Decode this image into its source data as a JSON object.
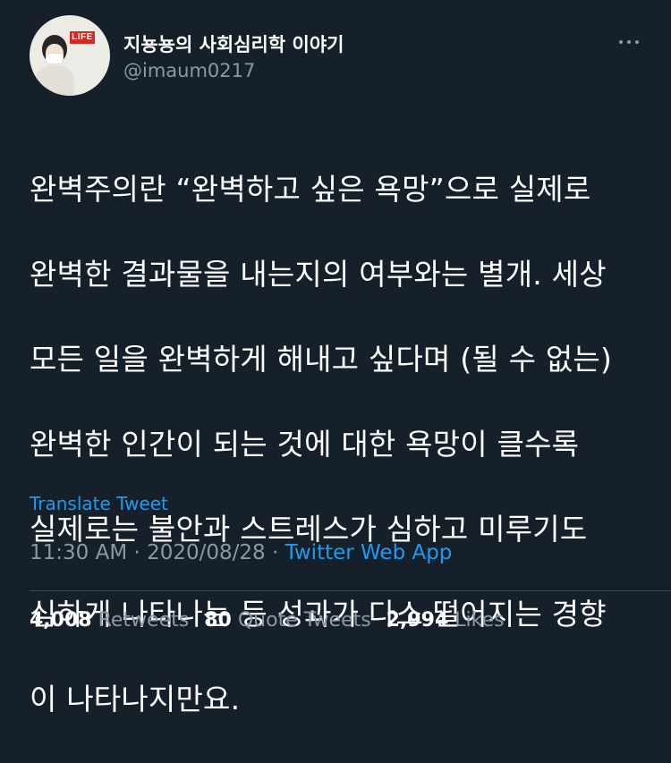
{
  "author": {
    "display_name": "지뇽뇽의 사회심리학 이야기",
    "handle": "@imaum0217",
    "avatar_sign_text": "LIFE"
  },
  "tweet": {
    "text_lines": [
      "완벽주의란 “완벽하고 싶은 욕망”으로 실제로",
      "완벽한 결과물을 내는지의 여부와는 별개. 세상",
      "모든 일을 완벽하게 해내고 싶다며 (될 수 없는)",
      "완벽한 인간이 되는 것에 대한 욕망이 클수록",
      "실제로는 불안과 스트레스가 심하고 미루기도",
      "심하게 나타나는 등 성과가 다소 떨어지는 경향",
      "이 나타나지만요."
    ],
    "translate_label": "Translate Tweet",
    "time": "11:30 AM",
    "separator": "·",
    "date": "2020/08/28",
    "source": "Twitter Web App"
  },
  "stats": {
    "retweets_count": "4,008",
    "retweets_label": "Retweets",
    "quotes_count": "80",
    "quotes_label": "Quote Tweets",
    "likes_count": "2,994",
    "likes_label": "Likes"
  },
  "colors": {
    "background": "#15202b",
    "text": "#ffffff",
    "secondary": "#8b98a5",
    "accent": "#1d9bf0"
  },
  "icons": {
    "more": "more-horizontal-icon"
  }
}
